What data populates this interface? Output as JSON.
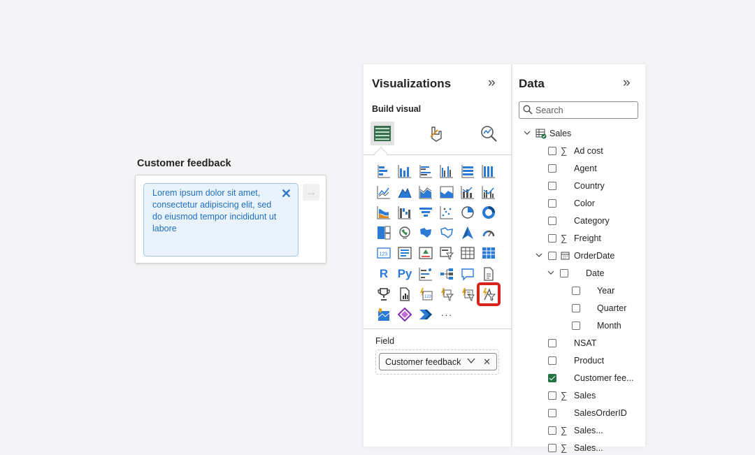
{
  "feedback_card": {
    "title": "Customer feedback",
    "text": "Lorem ipsum dolor sit amet, consectetur adipiscing elit, sed do eiusmod tempor incididunt ut labore",
    "clear_glyph": "✕",
    "submit_glyph": "→"
  },
  "visualizations": {
    "title": "Visualizations",
    "collapse_glyph": "»",
    "build_label": "Build visual",
    "mode_tabs": [
      "build-visual-icon",
      "format-visual-icon",
      "analytics-icon"
    ],
    "more_glyph": "···",
    "r_label": "R",
    "py_label": "Py",
    "field_label": "Field",
    "field_chip": "Customer feedback",
    "chip_chevron": "∨",
    "chip_remove": "✕",
    "selected_color": "#d8221c"
  },
  "data": {
    "title": "Data",
    "collapse_glyph": "»",
    "search_placeholder": "Search",
    "table_name": "Sales",
    "fields": [
      {
        "label": "Ad cost",
        "sigma": true,
        "checked": false
      },
      {
        "label": "Agent",
        "sigma": false,
        "checked": false
      },
      {
        "label": "Country",
        "sigma": false,
        "checked": false
      },
      {
        "label": "Color",
        "sigma": false,
        "checked": false
      },
      {
        "label": "Category",
        "sigma": false,
        "checked": false
      },
      {
        "label": "Freight",
        "sigma": true,
        "checked": false
      },
      {
        "label": "OrderDate",
        "sigma": false,
        "checked": false
      },
      {
        "label": "Date",
        "sigma": false,
        "checked": false
      },
      {
        "label": "Year",
        "sigma": false,
        "checked": false
      },
      {
        "label": "Quarter",
        "sigma": false,
        "checked": false
      },
      {
        "label": "Month",
        "sigma": false,
        "checked": false
      },
      {
        "label": "NSAT",
        "sigma": false,
        "checked": false
      },
      {
        "label": "Product",
        "sigma": false,
        "checked": false
      },
      {
        "label": "Customer fee...",
        "sigma": false,
        "checked": true
      },
      {
        "label": "Sales",
        "sigma": true,
        "checked": false
      },
      {
        "label": "SalesOrderID",
        "sigma": false,
        "checked": false
      },
      {
        "label": "Sales...",
        "sigma": true,
        "checked": false
      },
      {
        "label": "Sales...",
        "sigma": true,
        "checked": false
      }
    ],
    "sigma_glyph": "∑",
    "chevron_glyph": "∨",
    "check_color": "#217346"
  }
}
